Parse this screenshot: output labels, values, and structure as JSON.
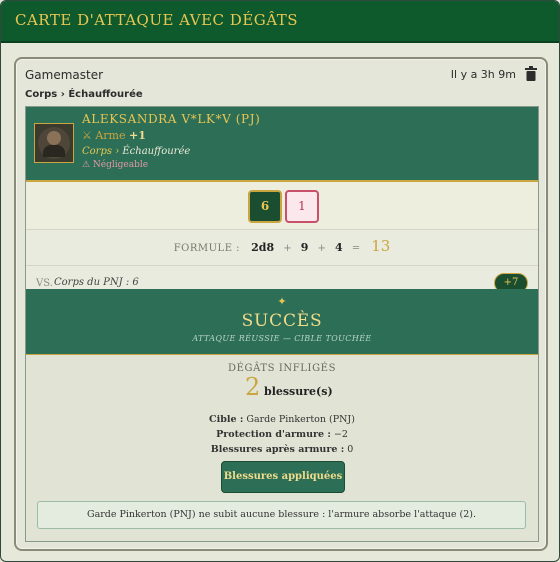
{
  "window": {
    "title": "CARTE D'ATTAQUE AVEC DÉGÂTS"
  },
  "card": {
    "author": "Gamemaster",
    "timestamp": "Il y a 3h 9m",
    "breadcrumb": "Corps › Échauffourée"
  },
  "attacker": {
    "name": "ALEKSANDRA V*LK*V (PJ)",
    "weapon_prefix": "⚔ Arme",
    "weapon_bonus": "+1",
    "location_main": "Corps",
    "location_sep": "›",
    "location_sub": "Échauffourée",
    "warning": "⚠ Négligeable"
  },
  "dice": [
    {
      "value": "6",
      "kind": "success"
    },
    {
      "value": "1",
      "kind": "failure"
    }
  ],
  "formula": {
    "label": "FORMULE :",
    "dice": "2d8",
    "op1": "+",
    "v1": "9",
    "op2": "+",
    "v2": "4",
    "eq": "=",
    "result": "13"
  },
  "versus": {
    "label": "VS.",
    "target": "Corps du PNJ : 6",
    "margin": "+7"
  },
  "outcome": {
    "star": "✦",
    "title": "SUCCÈS",
    "subtitle": "ATTAQUE RÉUSSIE — CIBLE TOUCHÉE"
  },
  "damage": {
    "label": "DÉGÂTS INFLIGÉS",
    "amount": "2",
    "unit": "blessure(s)",
    "target_label": "Cible :",
    "target_value": "Garde Pinkerton (PNJ)",
    "armor_label": "Protection d'armure :",
    "armor_value": "−2",
    "after_label": "Blessures après armure :",
    "after_value": "0",
    "apply_button": "Blessures appliquées",
    "message": "Garde Pinkerton (PNJ) ne subit aucune blessure : l'armure absorbe l'attaque (2)."
  },
  "colors": {
    "title_bar": "#0f5a2c",
    "accent_gold": "#c9a640",
    "panel_green": "#2d6e57",
    "failure_pink": "#c8506a"
  }
}
